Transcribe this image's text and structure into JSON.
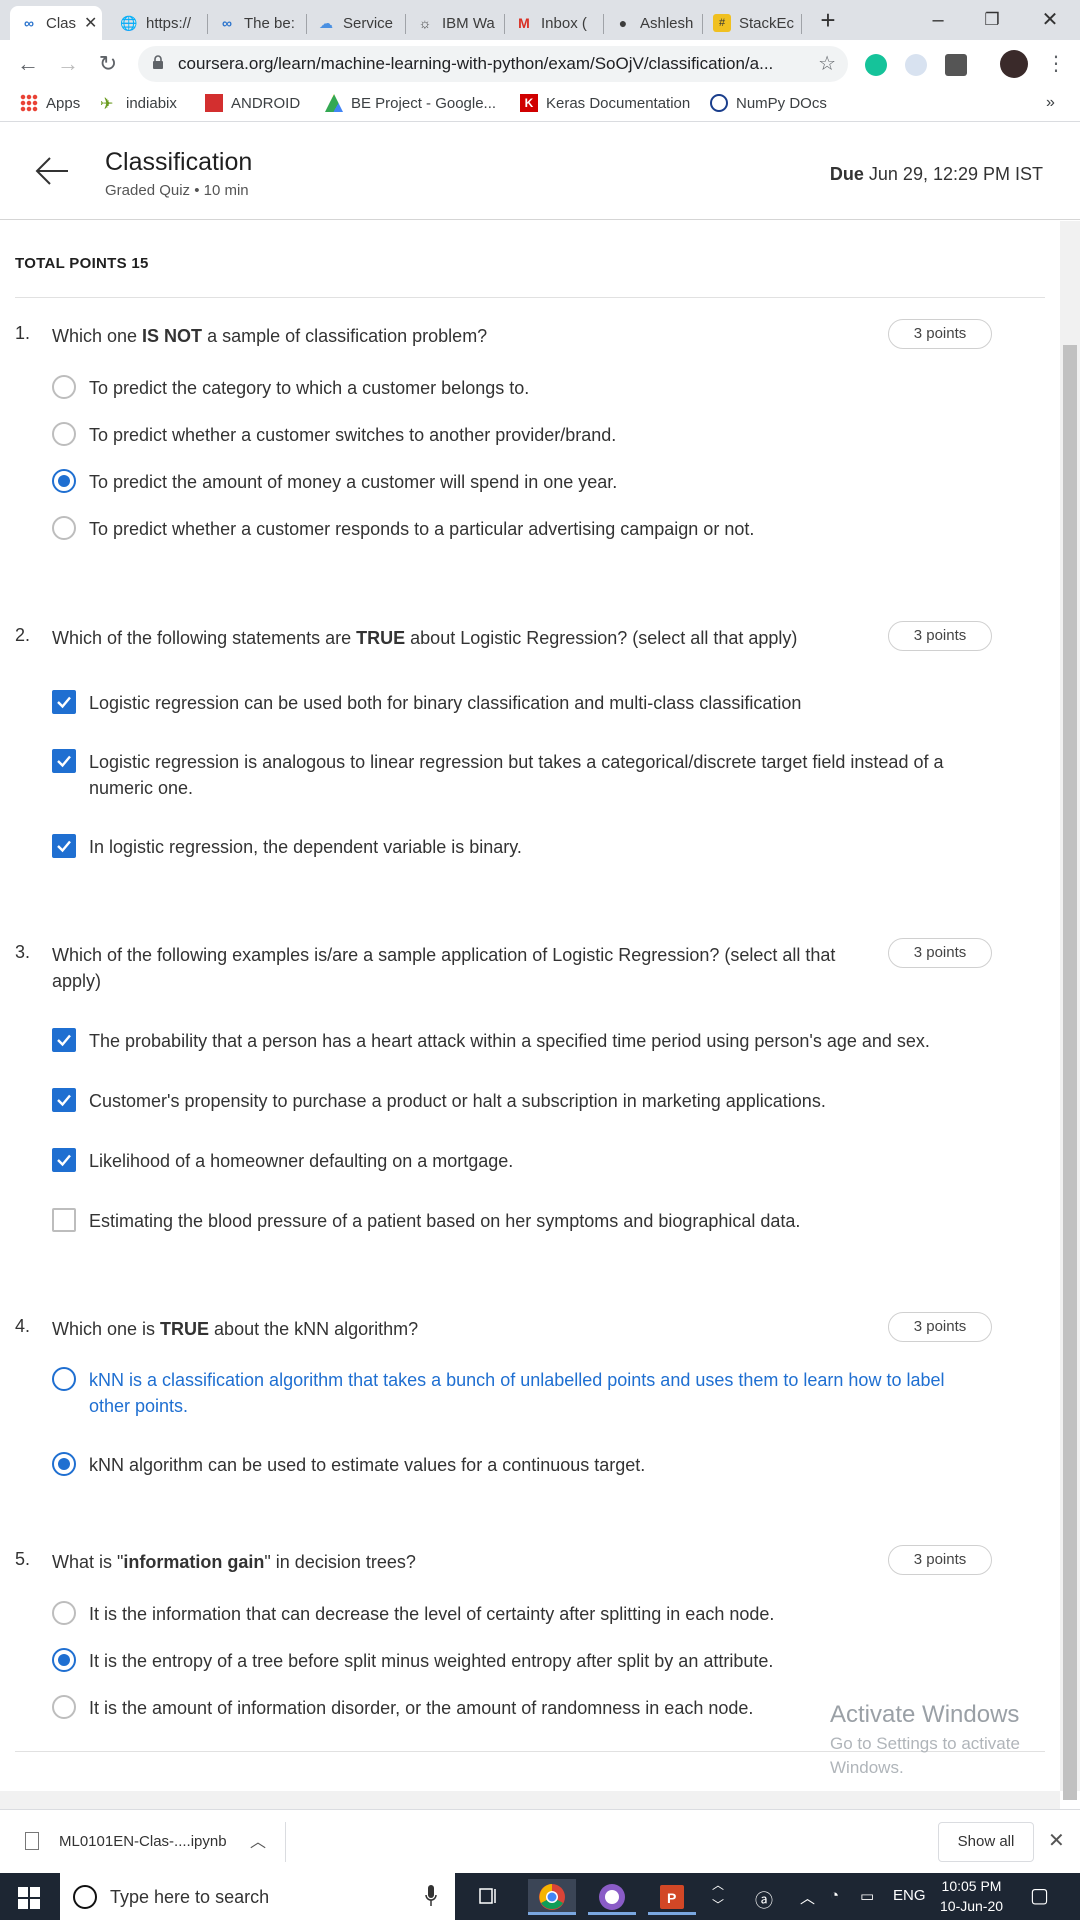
{
  "browser": {
    "tabs": [
      {
        "label": "Clas",
        "icon": "coursera-icon"
      },
      {
        "label": "https://",
        "icon": "globe-icon"
      },
      {
        "label": "The be:",
        "icon": "coursera-icon"
      },
      {
        "label": "Service",
        "icon": "cloud-icon"
      },
      {
        "label": "IBM Wa",
        "icon": "ibm-watson-icon"
      },
      {
        "label": "Inbox (",
        "icon": "gmail-icon"
      },
      {
        "label": "Ashlesh",
        "icon": "github-icon"
      },
      {
        "label": "StackEc",
        "icon": "stackedit-icon"
      }
    ],
    "url": "coursera.org/learn/machine-learning-with-python/exam/SoOjV/classification/a...",
    "bookmarks": [
      {
        "label": "Apps"
      },
      {
        "label": "indiabix"
      },
      {
        "label": "ANDROID"
      },
      {
        "label": "BE Project - Google..."
      },
      {
        "label": "Keras Documentation"
      },
      {
        "label": "NumPy DOcs"
      }
    ],
    "bookmarks_more": "»"
  },
  "header": {
    "title": "Classification",
    "subtitle": "Graded Quiz • 10 min",
    "due_label": "Due",
    "due_value": "Jun 29, 12:29 PM IST"
  },
  "quiz": {
    "total_points": "TOTAL POINTS 15",
    "questions": [
      {
        "number": "1.",
        "text_pre": "Which one ",
        "text_bold": "IS NOT",
        "text_post": " a sample of classification problem?",
        "points": "3 points",
        "type": "radio",
        "options": [
          {
            "text": "To predict the category to which a customer belongs to.",
            "selected": false
          },
          {
            "text": "To predict whether a customer switches to another provider/brand.",
            "selected": false
          },
          {
            "text": "To predict the amount of money a customer will spend in one year.",
            "selected": true
          },
          {
            "text": "To predict whether a customer responds to a particular advertising campaign or not.",
            "selected": false
          }
        ]
      },
      {
        "number": "2.",
        "text_pre": "Which of the following statements are ",
        "text_bold": "TRUE",
        "text_post": " about Logistic Regression? (select all that apply)",
        "points": "3 points",
        "type": "checkbox",
        "options": [
          {
            "text": "Logistic regression can be used both for binary classification and multi-class classification",
            "selected": true
          },
          {
            "text": "Logistic regression is analogous to linear regression but takes a categorical/discrete target field instead of a numeric one.",
            "selected": true
          },
          {
            "text": "In logistic regression, the dependent variable is binary.",
            "selected": true
          }
        ]
      },
      {
        "number": "3.",
        "text_pre": "Which of the following examples is/are a sample application of Logistic Regression? (select all that apply)",
        "text_bold": "",
        "text_post": "",
        "points": "3 points",
        "type": "checkbox",
        "options": [
          {
            "text": "The probability that a person has a heart attack within a specified time period using person's age and sex.",
            "selected": true
          },
          {
            "text": "Customer's propensity to purchase a product or halt a subscription in marketing applications.",
            "selected": true
          },
          {
            "text": "Likelihood of a homeowner defaulting on a mortgage.",
            "selected": true
          },
          {
            "text": "Estimating the blood pressure of a patient based on her symptoms and biographical data.",
            "selected": false
          }
        ]
      },
      {
        "number": "4.",
        "text_pre": "Which one is ",
        "text_bold": "TRUE",
        "text_post": " about the kNN algorithm?",
        "points": "3 points",
        "type": "radio",
        "options": [
          {
            "text": "kNN is a classification algorithm that takes a bunch of unlabelled points and uses them to learn how to label other points.",
            "selected": false,
            "hover": true
          },
          {
            "text": "kNN algorithm can be used to estimate values for a continuous target.",
            "selected": true
          }
        ]
      },
      {
        "number": "5.",
        "text_pre": "What is \"",
        "text_bold": "information gain",
        "text_post": "\" in decision trees?",
        "points": "3 points",
        "type": "radio",
        "options": [
          {
            "text": "It is the information that can decrease the level of certainty after splitting in each node.",
            "selected": false
          },
          {
            "text": "It is the entropy of a tree before split minus weighted entropy after split by an attribute.",
            "selected": true
          },
          {
            "text": "It is the amount of information disorder, or the amount of randomness in each node.",
            "selected": false
          }
        ]
      }
    ]
  },
  "watermark": {
    "title": "Activate Windows",
    "line1": "Go to Settings to activate",
    "line2": "Windows."
  },
  "downloads": {
    "file": "ML0101EN-Clas-....ipynb",
    "show_all": "Show all"
  },
  "taskbar": {
    "search_placeholder": "Type here to search",
    "lang": "ENG",
    "time": "10:05 PM",
    "date": "10-Jun-20"
  },
  "colors": {
    "accent": "#1f6fd1",
    "taskbar": "#1d2633"
  }
}
